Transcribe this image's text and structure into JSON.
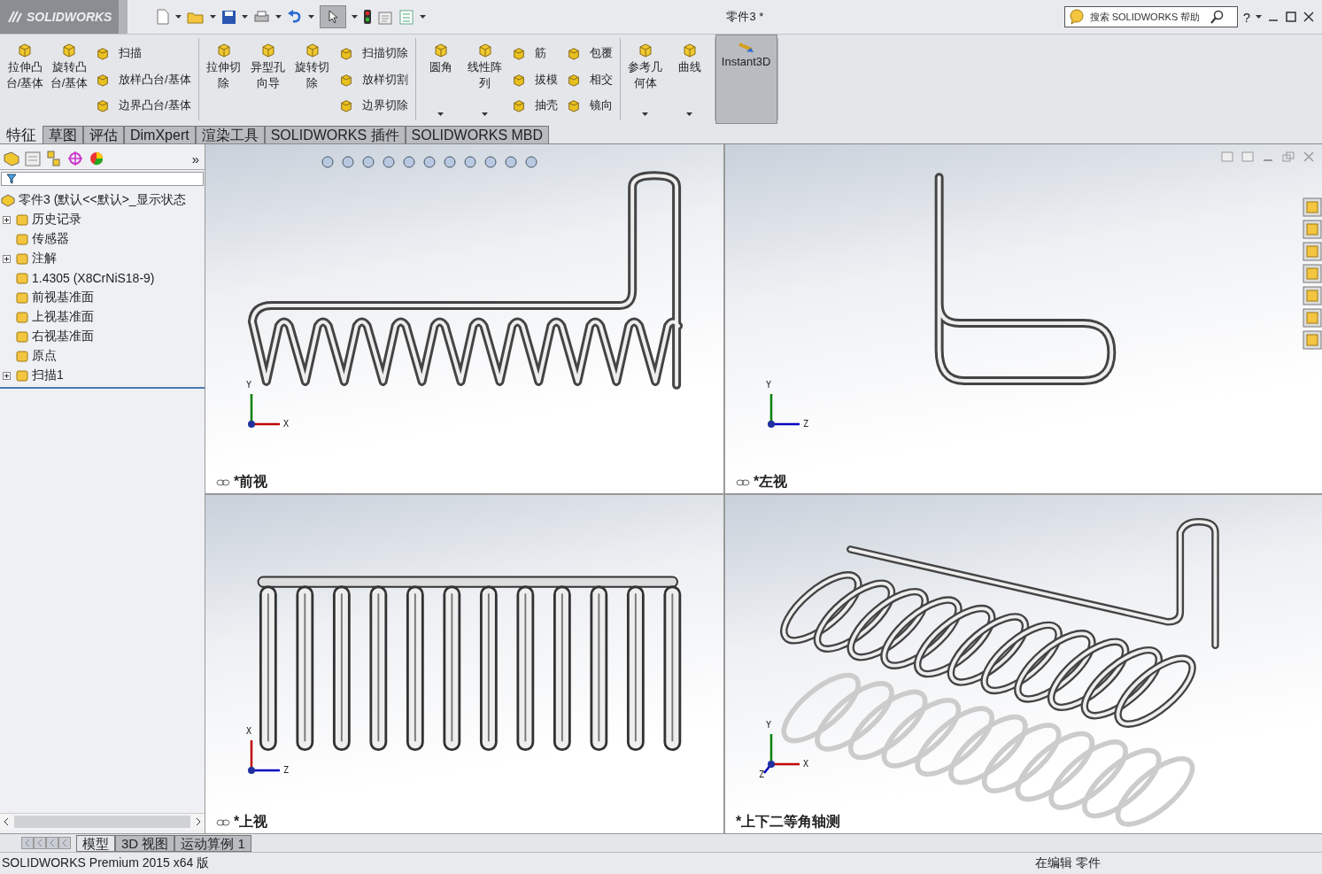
{
  "title_bar": {
    "logo": "SOLIDWORKS",
    "title": "零件3 *",
    "search": {
      "placeholder": "搜索 SOLIDWORKS 帮助"
    },
    "help": "?"
  },
  "ribbon": {
    "groups": [
      {
        "items": [
          {
            "kind": "large",
            "label": "拉伸凸台/基体",
            "dropdown": false
          },
          {
            "kind": "large",
            "label": "旋转凸台/基体",
            "dropdown": false
          },
          {
            "kind": "column",
            "labels": [
              "扫描",
              "放样凸台/基体",
              "边界凸台/基体"
            ]
          }
        ]
      },
      {
        "items": [
          {
            "kind": "large",
            "label": "拉伸切除",
            "dropdown": false
          },
          {
            "kind": "large",
            "label": "异型孔向导",
            "dropdown": false
          },
          {
            "kind": "large",
            "label": "旋转切除",
            "dropdown": false
          },
          {
            "kind": "column",
            "labels": [
              "扫描切除",
              "放样切割",
              "边界切除"
            ]
          }
        ]
      },
      {
        "items": [
          {
            "kind": "large",
            "label": "圆角",
            "dropdown": true
          },
          {
            "kind": "large",
            "label": "线性阵列",
            "dropdown": true
          },
          {
            "kind": "column",
            "labels": [
              "筋",
              "拔模",
              "抽壳"
            ]
          },
          {
            "kind": "column",
            "labels": [
              "包覆",
              "相交",
              "镜向"
            ]
          }
        ]
      },
      {
        "items": [
          {
            "kind": "large",
            "label": "参考几何体",
            "dropdown": true
          },
          {
            "kind": "large",
            "label": "曲线",
            "dropdown": true
          }
        ]
      },
      {
        "items": [
          {
            "kind": "toggle",
            "label": "Instant3D",
            "on": true
          }
        ]
      }
    ]
  },
  "command_tabs": [
    {
      "label": "特征",
      "selected": true
    },
    {
      "label": "草图",
      "selected": false
    },
    {
      "label": "评估",
      "selected": false
    },
    {
      "label": "DimXpert",
      "selected": false
    },
    {
      "label": "渲染工具",
      "selected": false
    },
    {
      "label": "SOLIDWORKS 插件",
      "selected": false
    },
    {
      "label": "SOLIDWORKS MBD",
      "selected": false
    }
  ],
  "feature_tree": {
    "more": "»",
    "root": "零件3  (默认<<默认>_显示状态",
    "items": [
      {
        "label": "历史记录",
        "expandable": true
      },
      {
        "label": "传感器",
        "expandable": false
      },
      {
        "label": "注解",
        "expandable": true
      },
      {
        "label": "1.4305 (X8CrNiS18-9)",
        "expandable": false
      },
      {
        "label": "前视基准面",
        "expandable": false
      },
      {
        "label": "上视基准面",
        "expandable": false
      },
      {
        "label": "右视基准面",
        "expandable": false
      },
      {
        "label": "原点",
        "expandable": false
      },
      {
        "label": "扫描1",
        "expandable": true
      }
    ]
  },
  "viewports": [
    {
      "kind": "front",
      "label": "*前视",
      "axes": [
        "Y",
        "X"
      ]
    },
    {
      "kind": "left",
      "label": "*左视",
      "axes": [
        "Y",
        "Z"
      ]
    },
    {
      "kind": "top",
      "label": "*上视",
      "axes": [
        "X",
        "Z"
      ]
    },
    {
      "kind": "iso",
      "label": "*上下二等角轴测",
      "axes": [
        "Y",
        "X",
        "Z"
      ]
    }
  ],
  "bottom_tabs": [
    {
      "label": "模型",
      "selected": true
    },
    {
      "label": "3D 视图",
      "selected": false
    },
    {
      "label": "运动算例 1",
      "selected": false
    }
  ],
  "status_bar": {
    "product": "SOLIDWORKS Premium 2015 x64 版",
    "mode": "在编辑 零件"
  }
}
